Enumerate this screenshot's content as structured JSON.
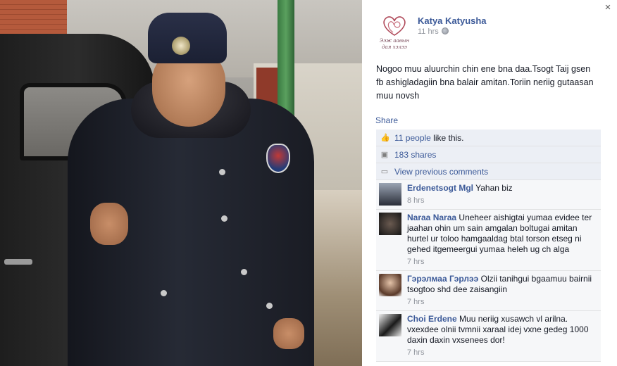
{
  "photo": {
    "icon": "photo-of-police-officer"
  },
  "post": {
    "author": "Katya Katyusha",
    "time": "11 hrs",
    "privacy_icon": "globe-icon",
    "avatar_caption": "Ээж аавын дая хэлээ",
    "text": "Nogoo muu aluurchin chin ene bna daa.Tsogt Taij gsen fb ashigladagiin bna balair amitan.Toriin neriig gutaasan muu novsh",
    "share_label": "Share",
    "close_label": "×"
  },
  "ufi": {
    "likes_link": "11 people",
    "likes_suffix": " like this.",
    "shares": "183 shares",
    "view_previous": "View previous comments"
  },
  "comments": [
    {
      "name": "Erdenetsogt Mgl",
      "text": "Yahan biz",
      "time": "8 hrs"
    },
    {
      "name": "Naraa Naraa",
      "text": "Uneheer aishigtai yumaa evidee ter jaahan ohin um sain amgalan boltugai amitan hurtel ur toloo hamgaaldag btal torson etseg ni gehed itgemeergui yumaa heleh ug ch alga",
      "time": "7 hrs"
    },
    {
      "name": "Гэрэлмаа Гэрлээ",
      "text": "Olzii tanihgui bgaamuu bairnii tsogtoo shd dee zaisangiin",
      "time": "7 hrs"
    },
    {
      "name": "Choi Erdene",
      "text": "Muu neriig xusawch vl arilna. vxexdee olnii tvmnii xaraal idej vxne gedeg 1000 daxin daxin vxsenees dor!",
      "time": "7 hrs"
    }
  ]
}
